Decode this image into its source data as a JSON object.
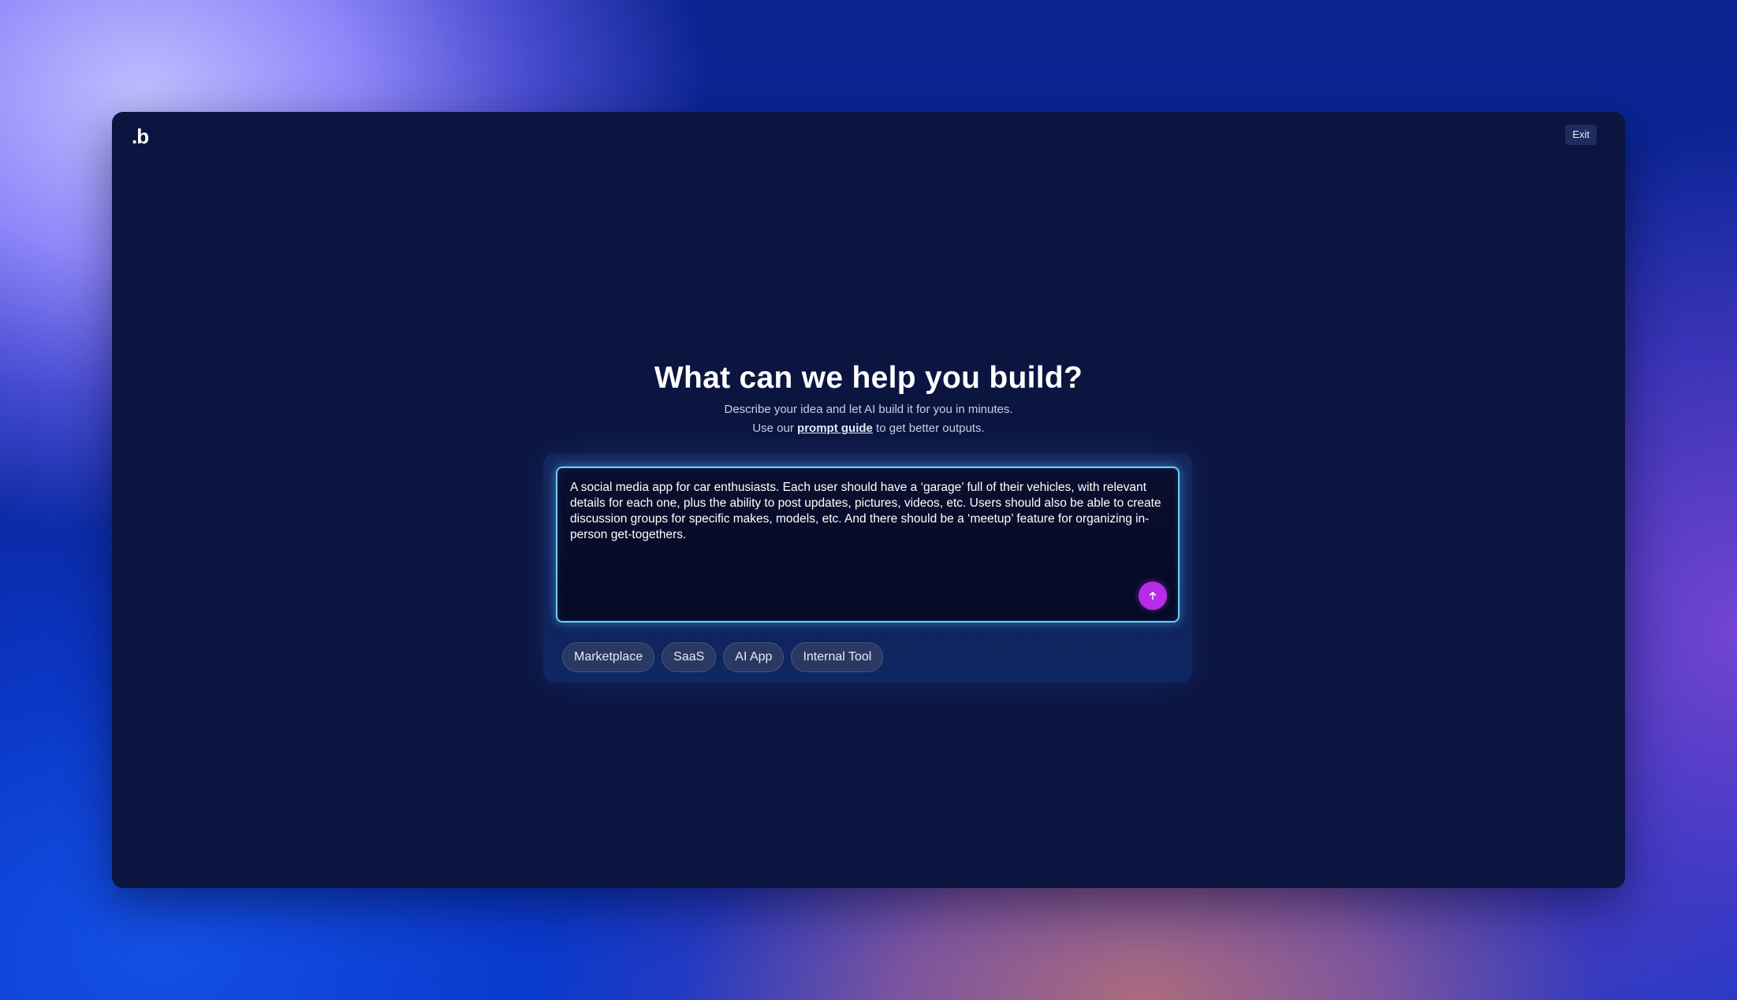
{
  "app": {
    "logo_text": ".b",
    "exit_label": "Exit"
  },
  "hero": {
    "title": "What can we help you build?",
    "subtitle": "Describe your idea and let AI build it for you in minutes.",
    "guide_prefix": "Use our",
    "guide_link": "prompt guide",
    "guide_suffix": "to get better outputs."
  },
  "prompt": {
    "value": "A social media app for car enthusiasts. Each user should have a ‘garage’ full of their vehicles, with relevant details for each one, plus the ability to post updates, pictures, videos, etc. Users should also be able to create discussion groups for specific makes, models, etc. And there should be a ‘meetup’ feature for organizing in-person get-togethers.",
    "submit_icon": "arrow-up-icon"
  },
  "categories": [
    {
      "label": "Marketplace"
    },
    {
      "label": "SaaS"
    },
    {
      "label": "AI App"
    },
    {
      "label": "Internal Tool"
    }
  ],
  "colors": {
    "window_bg": "#0c1540",
    "prompt_border": "#6fd0ff",
    "submit_bg": "#b72ce8",
    "chip_bg": "#2a3963"
  }
}
